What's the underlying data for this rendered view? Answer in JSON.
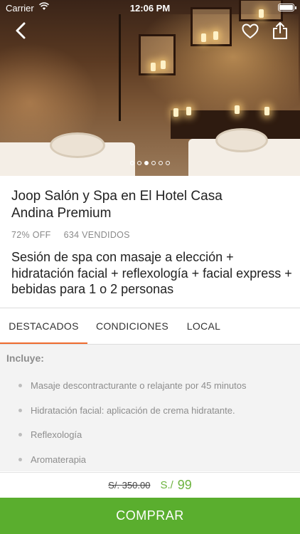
{
  "status_bar": {
    "carrier": "Carrier",
    "time": "12:06 PM"
  },
  "gallery": {
    "image_count": 6,
    "active_index": 2
  },
  "deal": {
    "title": "Joop Salón y Spa en El Hotel Casa Andina Premium",
    "discount": "72% OFF",
    "sold": "634 VENDIDOS",
    "description": "Sesión de spa con masaje a elección + hidratación facial + reflexología + facial express + bebidas para 1 o 2 personas"
  },
  "tabs": [
    {
      "label": "DESTACADOS",
      "active": true
    },
    {
      "label": "CONDICIONES",
      "active": false
    },
    {
      "label": "LOCAL",
      "active": false
    }
  ],
  "includes": {
    "title": "Incluye:",
    "items": [
      "Masaje descontracturante o relajante por 45 minutos",
      "Hidratación facial: aplicación de crema hidratante.",
      "Reflexología",
      "Aromaterapia"
    ]
  },
  "price": {
    "old": "S/. 350.00",
    "currency": "S./",
    "new": "99"
  },
  "buy_button": {
    "label": "COMPRAR"
  },
  "colors": {
    "accent": "#ef6b2e",
    "green": "#5aae2e",
    "price_green": "#6cb33e"
  }
}
